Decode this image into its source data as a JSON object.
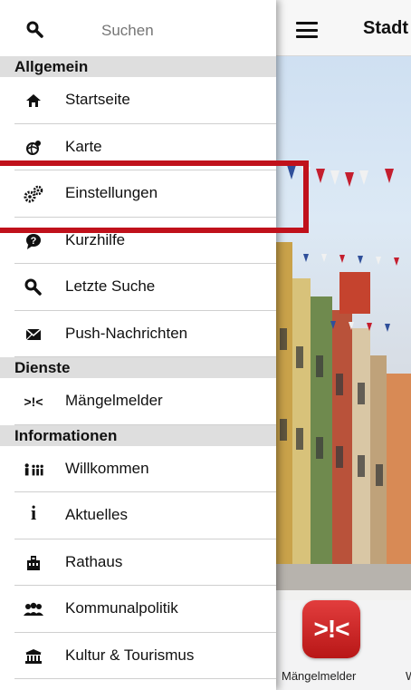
{
  "header": {
    "title": "Stadt"
  },
  "search": {
    "placeholder": "Suchen"
  },
  "sections": {
    "allgemein": "Allgemein",
    "dienste": "Dienste",
    "informationen": "Informationen"
  },
  "menu": {
    "startseite": "Startseite",
    "karte": "Karte",
    "einstellungen": "Einstellungen",
    "kurzhilfe": "Kurzhilfe",
    "letzte_suche": "Letzte Suche",
    "push": "Push-Nachrichten",
    "maengelmelder": "Mängelmelder",
    "willkommen": "Willkommen",
    "aktuelles": "Aktuelles",
    "rathaus": "Rathaus",
    "kommunalpolitik": "Kommunalpolitik",
    "kultur": "Kultur & Tourismus"
  },
  "icons": {
    "maengel_glyph": ">!<",
    "info_glyph": "i"
  },
  "bottom_tiles": [
    {
      "label": "Mängelmelder",
      "icon_text": ">!<"
    },
    {
      "label": "W"
    }
  ],
  "colors": {
    "highlight": "#c0111b",
    "section_bg": "#dedede",
    "tile_red": "#d92a2a"
  }
}
